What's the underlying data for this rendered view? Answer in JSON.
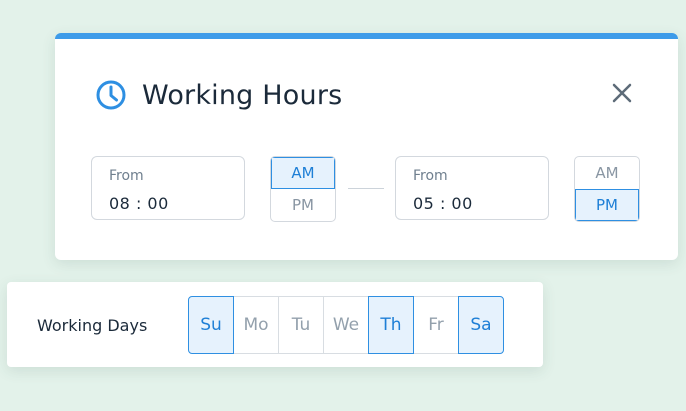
{
  "working_hours": {
    "title": "Working Hours",
    "from_start": {
      "label": "From",
      "value": "08 : 00"
    },
    "period_start": {
      "options": [
        "AM",
        "PM"
      ],
      "selected": "AM"
    },
    "from_end": {
      "label": "From",
      "value": "05 : 00"
    },
    "period_end": {
      "options": [
        "AM",
        "PM"
      ],
      "selected": "PM"
    }
  },
  "working_days": {
    "label": "Working Days",
    "days": [
      {
        "label": "Su",
        "selected": true
      },
      {
        "label": "Mo",
        "selected": false
      },
      {
        "label": "Tu",
        "selected": false
      },
      {
        "label": "We",
        "selected": false
      },
      {
        "label": "Th",
        "selected": true
      },
      {
        "label": "Fr",
        "selected": false
      },
      {
        "label": "Sa",
        "selected": true
      }
    ]
  },
  "colors": {
    "accent": "#3d9be9",
    "selected_bg": "#e6f2fd",
    "selected_text": "#1e7fd6",
    "background": "#e3f2ea"
  },
  "icons": {
    "title": "clock-icon",
    "close": "close-icon"
  }
}
